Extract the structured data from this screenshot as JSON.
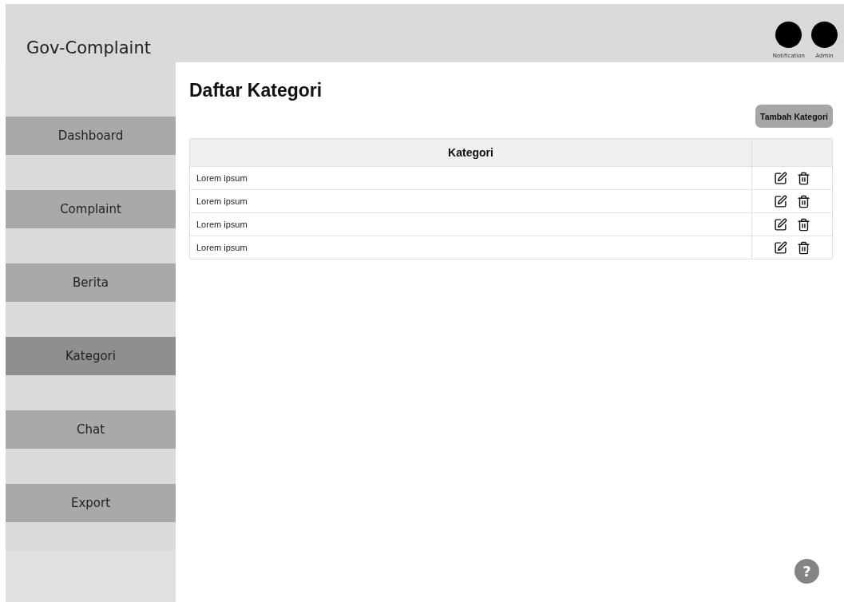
{
  "header": {
    "logo": "Gov-Complaint",
    "actions": [
      {
        "label": "Notification"
      },
      {
        "label": "Admin"
      }
    ]
  },
  "sidebar": {
    "items": [
      {
        "label": "Dashboard",
        "selected": false
      },
      {
        "label": "Complaint",
        "selected": false
      },
      {
        "label": "Berita",
        "selected": false
      },
      {
        "label": "Kategori",
        "selected": true
      },
      {
        "label": "Chat",
        "selected": false
      },
      {
        "label": "Export",
        "selected": false
      }
    ]
  },
  "page": {
    "title": "Daftar Kategori",
    "add_button": "Tambah Kategori"
  },
  "table": {
    "columns": [
      "Kategori"
    ],
    "rows": [
      {
        "name": "Lorem ipsum"
      },
      {
        "name": "Lorem ipsum"
      },
      {
        "name": "Lorem ipsum"
      },
      {
        "name": "Lorem ipsum"
      }
    ]
  },
  "help_button": "?"
}
